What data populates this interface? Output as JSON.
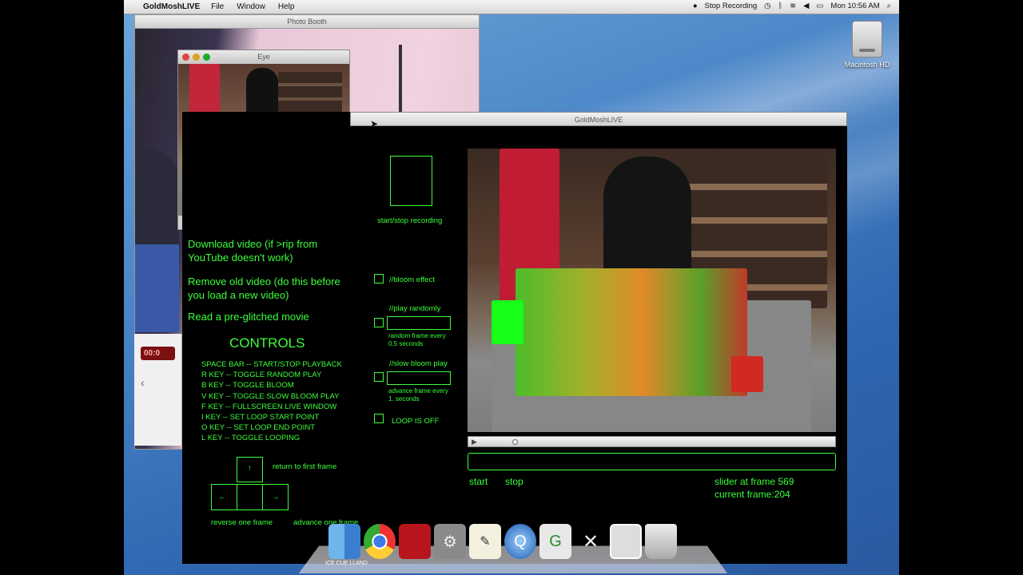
{
  "menubar": {
    "apple_icon": "apple-logo-icon",
    "app_name": "GoldMoshLIVE",
    "menus": [
      "File",
      "Window",
      "Help"
    ],
    "status": "Stop Recording",
    "clock": "Mon 10:56 AM"
  },
  "desktop": {
    "drive_label": "Macintosh HD"
  },
  "photobooth": {
    "title": "Photo Booth",
    "timer": "00:0"
  },
  "eye_window": {
    "title": "Eye"
  },
  "goldmosh": {
    "title": "GoldMoshLIVE",
    "links": {
      "download": "Download video (if >rip from YouTube doesn't work)",
      "remove": "Remove old video (do this before you load a new video)",
      "read": "Read a pre-glitched movie"
    },
    "record_label": "start/stop recording",
    "bloom_label": "//bloom effect",
    "play_randomly_label": "//play randomly",
    "random_frame_note": "random frame every 0.5 seconds",
    "slow_bloom_label": "//slow bloom play",
    "advance_frame_note": "advance frame every 1. seconds",
    "loop_label": "LOOP IS OFF",
    "controls_title": "CONTROLS",
    "keys": [
      "SPACE BAR -- START/STOP PLAYBACK",
      "R KEY -- TOGGLE RANDOM PLAY",
      "B KEY -- TOGGLE BLOOM",
      "V KEY -- TOGGLE SLOW BLOOM PLAY",
      "F KEY -- FULLSCREEN LIVE WINDOW",
      "I KEY -- SET LOOP START POINT",
      "O KEY -- SET LOOP END POINT",
      "L KEY -- TOGGLE LOOPING"
    ],
    "return_first": "return to first frame",
    "reverse_one": "reverse one frame",
    "advance_one": "advance one frame",
    "start": "start",
    "stop": "stop",
    "slider_frame": "slider at frame 569",
    "current_frame": "current frame:204",
    "colors": {
      "accent": "#3cff3c"
    }
  },
  "dock": {
    "items": [
      "finder-icon",
      "chrome-icon",
      "photo-booth-icon",
      "system-preferences-icon",
      "textedit-icon",
      "quicktime-icon",
      "grapher-icon",
      "xcode-icon",
      "preview-icon",
      "trash-icon"
    ],
    "finder_caption": "ICE CUE LLAND"
  }
}
